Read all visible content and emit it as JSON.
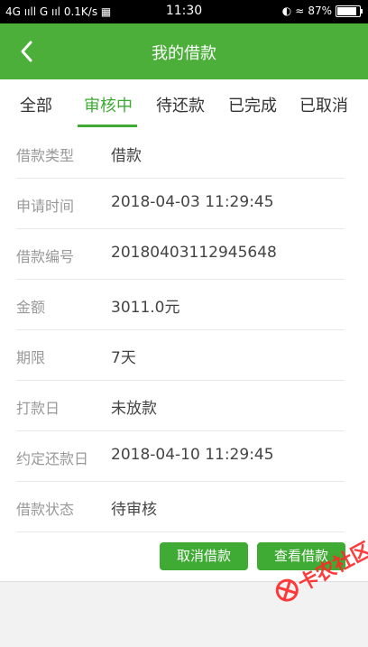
{
  "status_bar": {
    "network": "4G ııll G ııl",
    "speed": "0.1K/s",
    "time": "11:30",
    "battery": "87%",
    "battery_level": 0.87
  },
  "header": {
    "title": "我的借款"
  },
  "tabs": [
    {
      "label": "全部",
      "active": false
    },
    {
      "label": "审核中",
      "active": true
    },
    {
      "label": "待还款",
      "active": false
    },
    {
      "label": "已完成",
      "active": false
    },
    {
      "label": "已取消",
      "active": false
    }
  ],
  "details": [
    {
      "label": "借款类型",
      "value": "借款"
    },
    {
      "label": "申请时间",
      "value": "2018-04-03 11:29:45"
    },
    {
      "label": "借款编号",
      "value": "20180403112945648"
    },
    {
      "label": "金额",
      "value": "3011.0元"
    },
    {
      "label": "期限",
      "value": "7天"
    },
    {
      "label": "打款日",
      "value": "未放款"
    },
    {
      "label": "约定还款日",
      "value": "2018-04-10 11:29:45"
    },
    {
      "label": "借款状态",
      "value": "待审核"
    }
  ],
  "actions": {
    "cancel_label": "取消借款",
    "view_label": "查看借款"
  },
  "watermark": {
    "text": "卡农社区"
  },
  "colors": {
    "brand": "#4caf3a",
    "accent": "#3faa34",
    "watermark": "#ff2a2a"
  }
}
